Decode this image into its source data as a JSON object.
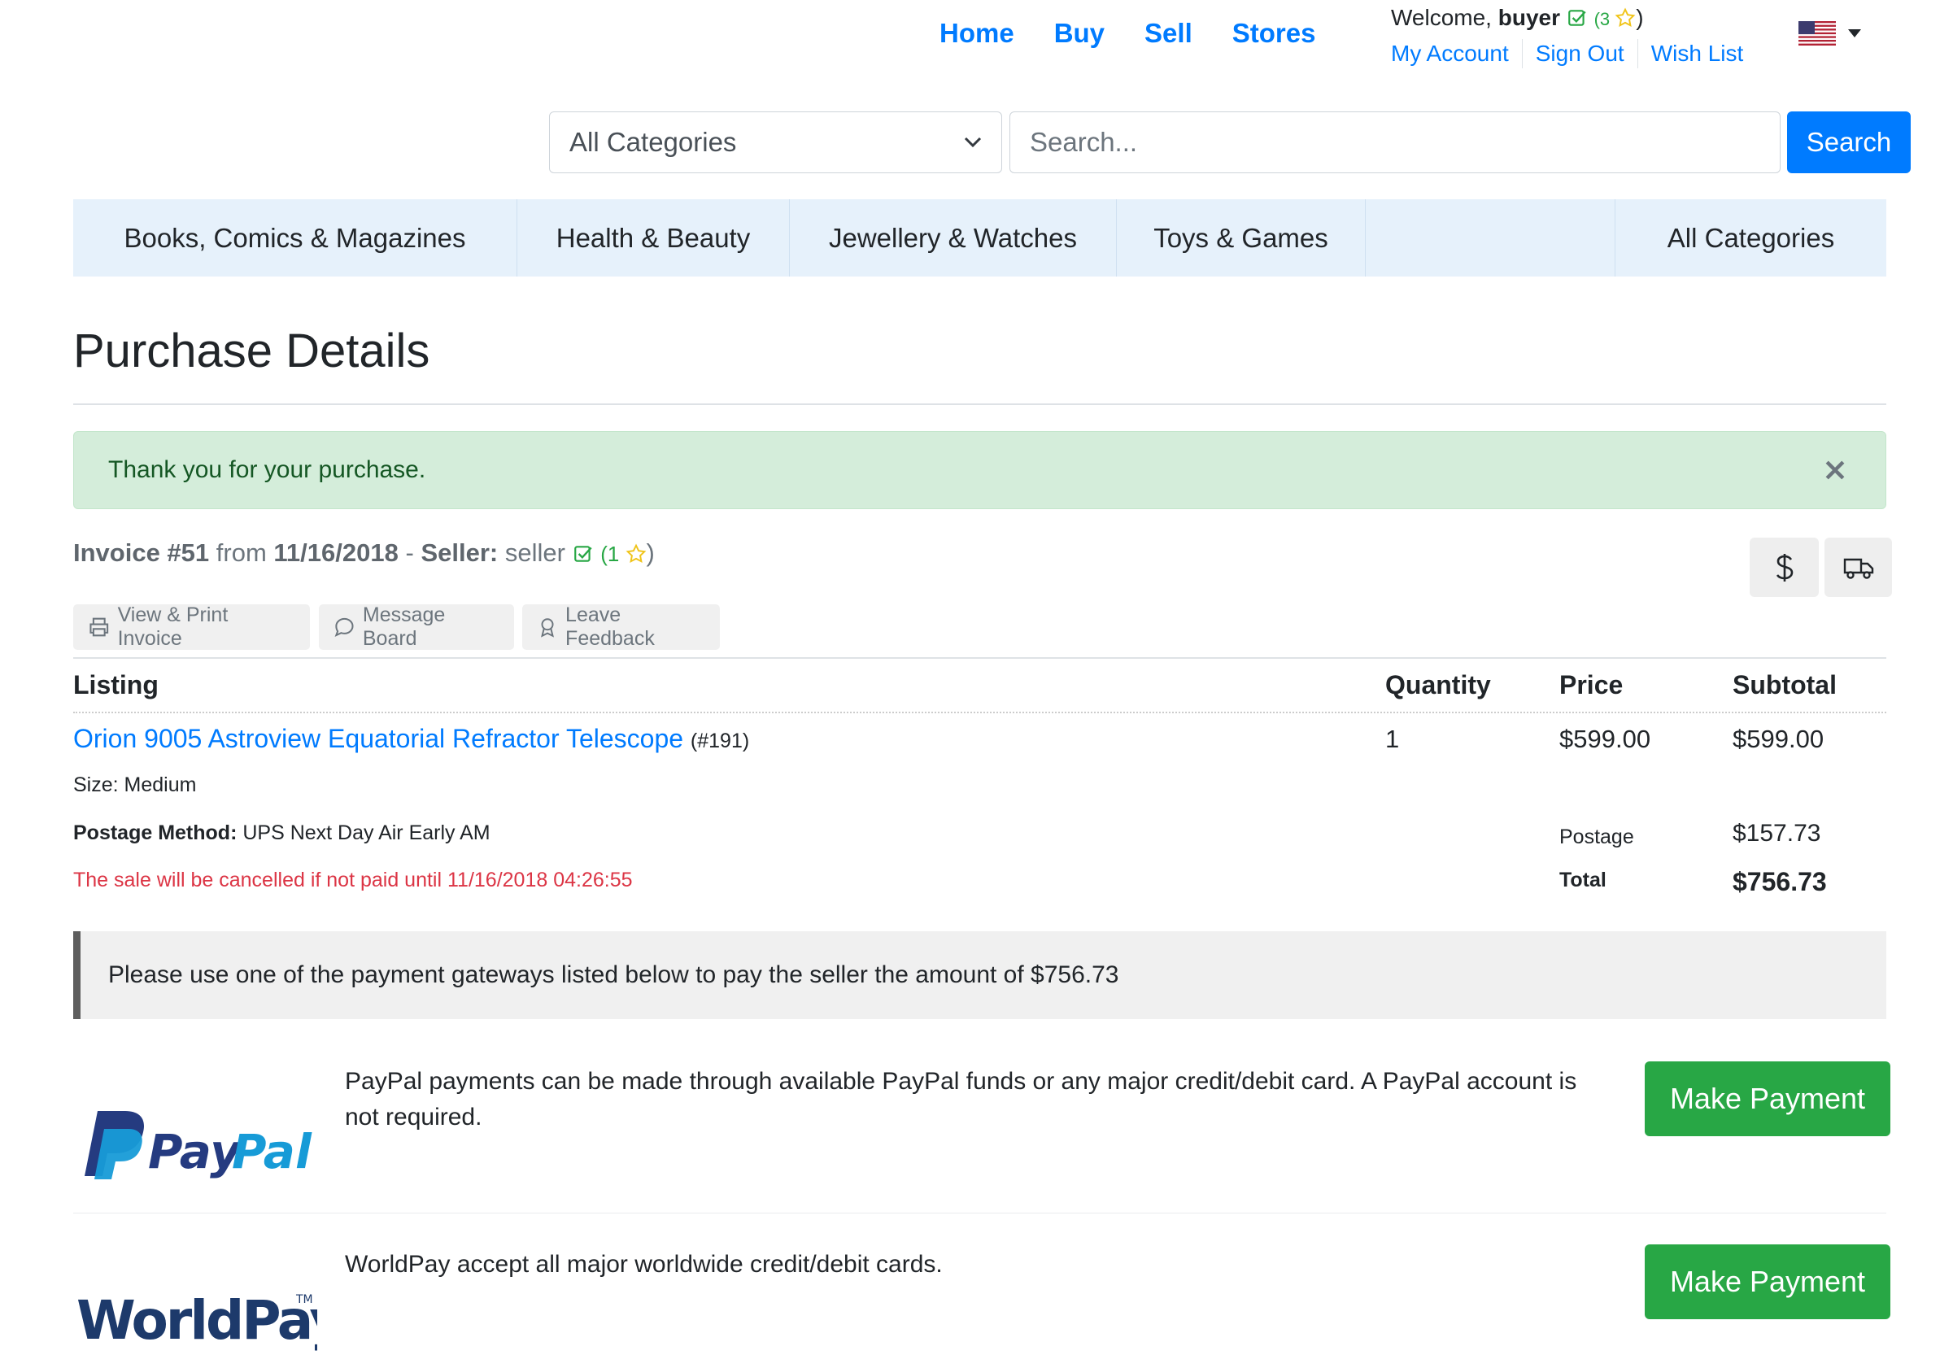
{
  "nav": {
    "links": [
      "Home",
      "Buy",
      "Sell",
      "Stores"
    ],
    "welcome_prefix": "Welcome,",
    "username": "buyer",
    "rating_open": "(3",
    "rating_close": ")",
    "account_links": [
      "My Account",
      "Sign Out",
      "Wish List"
    ]
  },
  "search": {
    "category_value": "All Categories",
    "placeholder": "Search...",
    "button_label": "Search"
  },
  "categories": {
    "items": [
      "Books, Comics & Magazines",
      "Health & Beauty",
      "Jewellery & Watches",
      "Toys & Games"
    ],
    "all_label": "All Categories"
  },
  "page": {
    "title": "Purchase Details"
  },
  "alert": {
    "message": "Thank you for your purchase."
  },
  "invoice": {
    "label": "Invoice #51",
    "from_word": "from",
    "date": "11/16/2018",
    "separator": "-",
    "seller_label": "Seller:",
    "seller_name": "seller",
    "seller_rating_open": "(1",
    "seller_rating_close": ")"
  },
  "actions": {
    "view_print": "View & Print Invoice",
    "message_board": "Message Board",
    "leave_feedback": "Leave Feedback"
  },
  "table": {
    "headers": {
      "listing": "Listing",
      "quantity": "Quantity",
      "price": "Price",
      "subtotal": "Subtotal"
    },
    "row": {
      "title": "Orion 9005 Astroview Equatorial Refractor Telescope",
      "number": "(#191)",
      "quantity": "1",
      "price": "$599.00",
      "subtotal": "$599.00",
      "size_label": "Size:",
      "size_value": "Medium"
    },
    "postage_method_label": "Postage Method:",
    "postage_method_value": "UPS Next Day Air Early AM",
    "postage_label": "Postage",
    "postage_value": "$157.73",
    "total_label": "Total",
    "total_value": "$756.73",
    "cancel_warning": "The sale will be cancelled if not paid until 11/16/2018 04:26:55"
  },
  "payment": {
    "notice": "Please use one of the payment gateways listed below to pay the seller the amount of $756.73",
    "gateways": [
      {
        "name": "PayPal",
        "description": "PayPal payments can be made through available PayPal funds or any major credit/debit card. A PayPal account is not required.",
        "button": "Make Payment"
      },
      {
        "name": "WorldPay",
        "description": "WorldPay accept all major worldwide credit/debit cards.",
        "button": "Make Payment"
      }
    ]
  },
  "colors": {
    "link": "#007bff",
    "success": "#28a745",
    "danger": "#dc3545",
    "alert_bg": "#d4edda",
    "category_bar_bg": "#e6f1fb",
    "star": "#f0c419"
  }
}
